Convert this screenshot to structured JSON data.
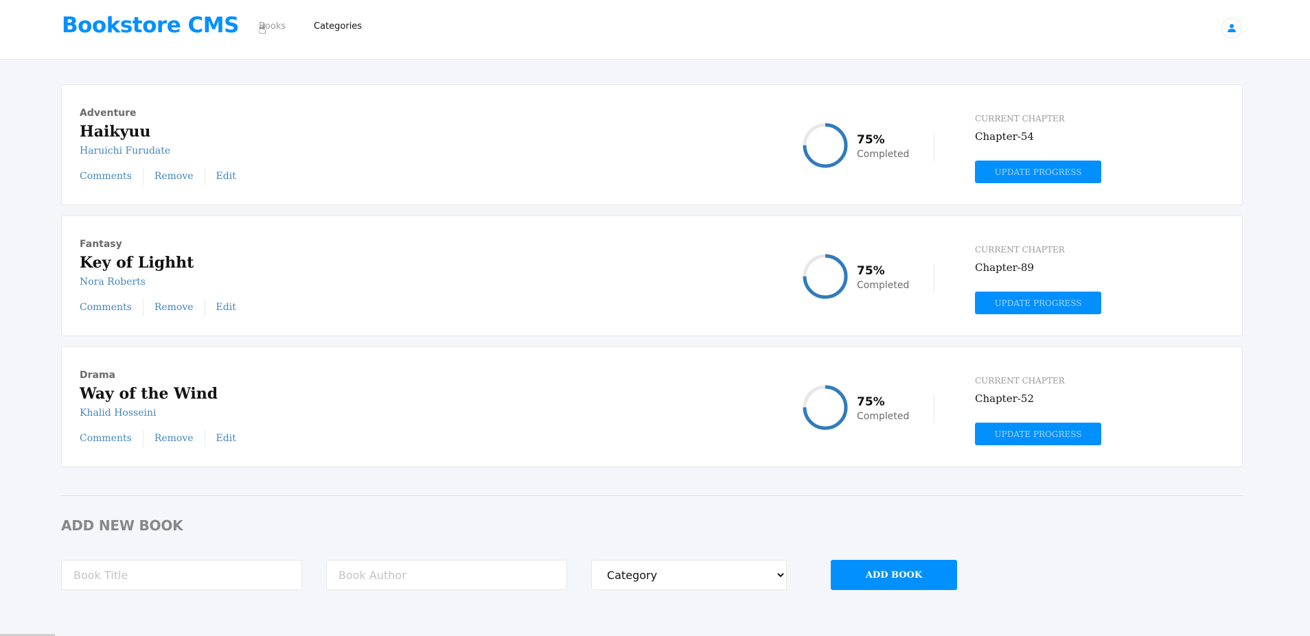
{
  "header": {
    "logo": "Bookstore CMS",
    "nav": [
      {
        "label": "Books"
      },
      {
        "label": "Categories"
      }
    ]
  },
  "books": [
    {
      "genre": "Adventure",
      "title": "Haikyuu",
      "author": "Haruichi Furudate",
      "actions": [
        "Comments",
        "Remove",
        "Edit"
      ],
      "progress_percent": 75,
      "percent_label": "75%",
      "completed_label": "Completed",
      "chapter_label": "CURRENT CHAPTER",
      "chapter": "Chapter-54",
      "update_label": "UPDATE PROGRESS"
    },
    {
      "genre": "Fantasy",
      "title": "Key of Lighht",
      "author": "Nora Roberts",
      "actions": [
        "Comments",
        "Remove",
        "Edit"
      ],
      "progress_percent": 75,
      "percent_label": "75%",
      "completed_label": "Completed",
      "chapter_label": "CURRENT CHAPTER",
      "chapter": "Chapter-89",
      "update_label": "UPDATE PROGRESS"
    },
    {
      "genre": "Drama",
      "title": "Way of the Wind",
      "author": "Khalid Hosseini",
      "actions": [
        "Comments",
        "Remove",
        "Edit"
      ],
      "progress_percent": 75,
      "percent_label": "75%",
      "completed_label": "Completed",
      "chapter_label": "CURRENT CHAPTER",
      "chapter": "Chapter-52",
      "update_label": "UPDATE PROGRESS"
    }
  ],
  "form": {
    "title": "ADD NEW BOOK",
    "title_placeholder": "Book Title",
    "author_placeholder": "Book Author",
    "category_selected": "Category",
    "submit_label": "ADD BOOK"
  },
  "colors": {
    "accent": "#0290ff",
    "progress_arc": "#307bbe",
    "progress_track": "#e8e8e8",
    "link": "#4386bf",
    "background": "#f5f6fa"
  },
  "icons": {
    "avatar": "user-icon",
    "cursor": "hand-pointer-icon"
  }
}
